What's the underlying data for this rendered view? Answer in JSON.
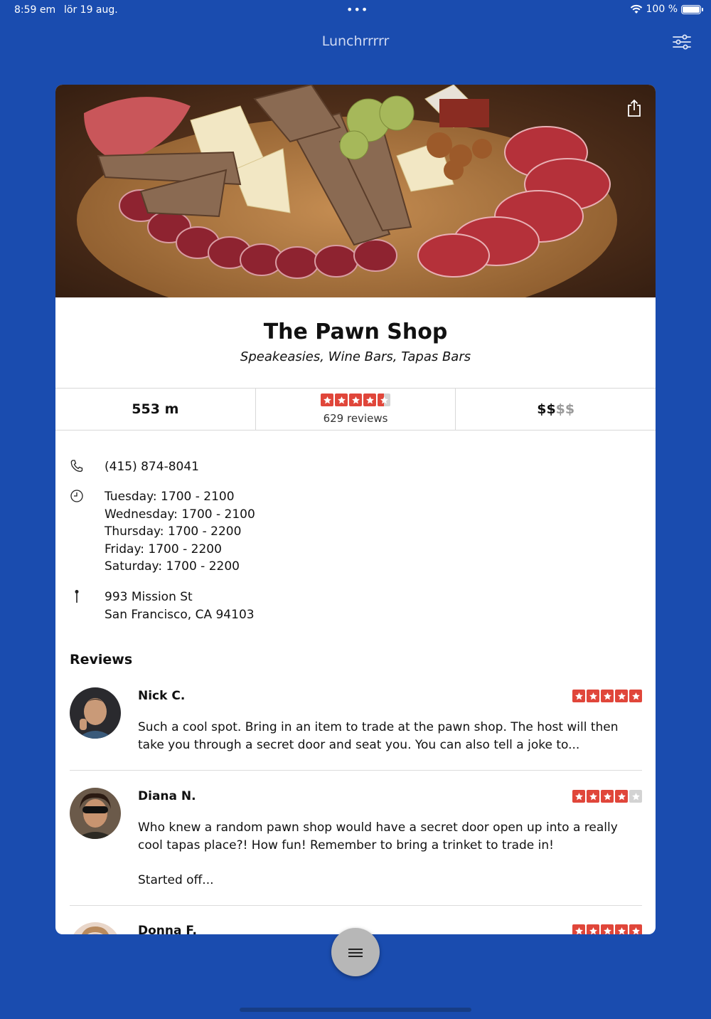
{
  "status_bar": {
    "time": "8:59 em",
    "date": "lör 19 aug.",
    "battery": "100 %"
  },
  "nav": {
    "title": "Lunchrrrrr"
  },
  "restaurant": {
    "name": "The Pawn Shop",
    "categories": "Speakeasies, Wine Bars, Tapas Bars",
    "distance": "553 m",
    "rating": 4.5,
    "review_count": "629 reviews",
    "price_active": "$$",
    "price_inactive": "$$",
    "phone": "(415) 874-8041",
    "hours": [
      "Tuesday: 1700 - 2100",
      "Wednesday: 1700 - 2100",
      "Thursday: 1700 - 2200",
      "Friday: 1700 - 2200",
      "Saturday: 1700 - 2200"
    ],
    "address_line1": "993 Mission St",
    "address_line2": "San Francisco, CA 94103"
  },
  "reviews_heading": "Reviews",
  "reviews": [
    {
      "name": "Nick C.",
      "rating": 5,
      "text": "Such a cool spot. Bring in an item to trade at the pawn shop. The host will then take you through a secret door and seat you. You can also tell a joke to..."
    },
    {
      "name": "Diana N.",
      "rating": 4,
      "text": "Who knew a random pawn shop would have a secret door open up into a really cool tapas place?! How fun! Remember to bring a trinket to trade in!\n\nStarted off..."
    },
    {
      "name": "Donna F.",
      "rating": 5,
      "text": ""
    }
  ],
  "colors": {
    "background": "#1a4caf",
    "star_red": "#e0463a",
    "star_off": "#d3d3d3"
  },
  "icons": {
    "filter": "sliders-icon",
    "share": "share-icon",
    "phone": "phone-icon",
    "hours": "clock-icon",
    "address": "pin-icon",
    "fab": "menu-icon"
  }
}
